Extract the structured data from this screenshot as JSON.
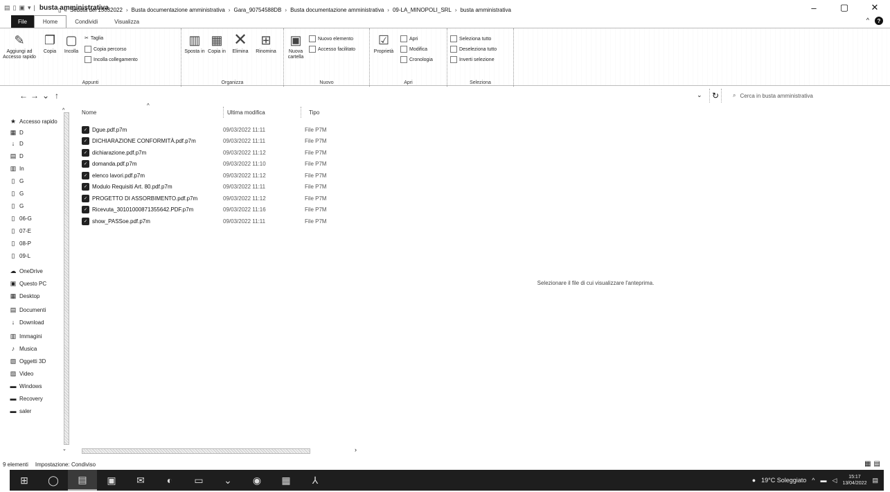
{
  "window": {
    "title": "busta amministrativa",
    "minimize": "–",
    "maximize": "▢",
    "close": "✕"
  },
  "ribbon_tabs": [
    "File",
    "Home",
    "Condividi",
    "Visualizza"
  ],
  "ribbon": {
    "appunti": {
      "label": "Appunti",
      "pin": "Aggiungi ad Accesso rapido",
      "copy": "Copia",
      "paste": "Incolla",
      "cut": "Taglia",
      "copy_path": "Copia percorso",
      "paste_shortcut": "Incolla collegamento"
    },
    "organizza": {
      "label": "Organizza",
      "move_to": "Sposta in",
      "copy_to": "Copia in",
      "delete": "Elimina",
      "rename": "Rinomina"
    },
    "nuovo": {
      "label": "Nuovo",
      "new_folder": "Nuova cartella",
      "new_item": "Nuovo elemento",
      "easy_access": "Accesso facilitato"
    },
    "apri": {
      "label": "Apri",
      "properties": "Proprietà",
      "open": "Apri",
      "edit": "Modifica",
      "history": "Cronologia"
    },
    "seleziona": {
      "label": "Seleziona",
      "select_all": "Seleziona tutto",
      "select_none": "Deseleziona tutto",
      "invert": "Inverti selezione"
    }
  },
  "address": {
    "prefix": "«",
    "crumbs": [
      "Seduta del 15032022",
      "Busta documentazione amministrativa",
      "Gara_90754588DB",
      "Busta documentazione amministrativa",
      "09-LA_MINOPOLI_SRL",
      "busta amministrativa"
    ],
    "search_placeholder": "Cerca in busta amministrativa"
  },
  "nav": {
    "items": [
      {
        "icon": "★",
        "label": "Accesso rapido"
      },
      {
        "icon": "▦",
        "label": "D"
      },
      {
        "icon": "↓",
        "label": "D"
      },
      {
        "icon": "▤",
        "label": "D"
      },
      {
        "icon": "▥",
        "label": "In"
      },
      {
        "icon": "▯",
        "label": "G"
      },
      {
        "icon": "▯",
        "label": "G"
      },
      {
        "icon": "▯",
        "label": "G"
      },
      {
        "icon": "▯",
        "label": "06-G"
      },
      {
        "icon": "▯",
        "label": "07-E"
      },
      {
        "icon": "▯",
        "label": "08-P"
      },
      {
        "icon": "▯",
        "label": "09-L"
      },
      {
        "icon": "☁",
        "label": "OneDrive"
      },
      {
        "icon": "▣",
        "label": "Questo PC"
      },
      {
        "icon": "▦",
        "label": "Desktop"
      },
      {
        "icon": "▤",
        "label": "Documenti"
      },
      {
        "icon": "↓",
        "label": "Download"
      },
      {
        "icon": "▥",
        "label": "Immagini"
      },
      {
        "icon": "♪",
        "label": "Musica"
      },
      {
        "icon": "▧",
        "label": "Oggetti 3D"
      },
      {
        "icon": "▨",
        "label": "Video"
      },
      {
        "icon": "▬",
        "label": "Windows"
      },
      {
        "icon": "▬",
        "label": "Recovery"
      },
      {
        "icon": "▬",
        "label": "saler"
      }
    ]
  },
  "columns": {
    "name": "Nome",
    "modified": "Ultima modifica",
    "type": "Tipo"
  },
  "files": [
    {
      "name": "Dgue.pdf.p7m",
      "date": "09/03/2022 11:11",
      "type": "File P7M"
    },
    {
      "name": "DICHIARAZIONE CONFORMITÀ.pdf.p7m",
      "date": "09/03/2022 11:11",
      "type": "File P7M"
    },
    {
      "name": "dichiarazione.pdf.p7m",
      "date": "09/03/2022 11:12",
      "type": "File P7M"
    },
    {
      "name": "domanda.pdf.p7m",
      "date": "09/03/2022 11:10",
      "type": "File P7M"
    },
    {
      "name": "elenco lavori.pdf.p7m",
      "date": "09/03/2022 11:12",
      "type": "File P7M"
    },
    {
      "name": "Modulo Requisiti Art. 80.pdf.p7m",
      "date": "09/03/2022 11:11",
      "type": "File P7M"
    },
    {
      "name": "PROGETTO DI ASSORBIMENTO.pdf.p7m",
      "date": "09/03/2022 11:12",
      "type": "File P7M"
    },
    {
      "name": "Ricevuta_30101000871355642.PDF.p7m",
      "date": "09/03/2022 11:16",
      "type": "File P7M"
    },
    {
      "name": "show_PASSoe.pdf.p7m",
      "date": "09/03/2022 11:11",
      "type": "File P7M"
    }
  ],
  "preview_text": "Selezionare il file di cui visualizzare l'anteprima.",
  "status": {
    "count": "9 elementi",
    "sharing": "Impostazione: Condiviso"
  },
  "taskbar": {
    "weather": "19°C Soleggiato",
    "time": "15:17",
    "date": "13/04/2022"
  }
}
